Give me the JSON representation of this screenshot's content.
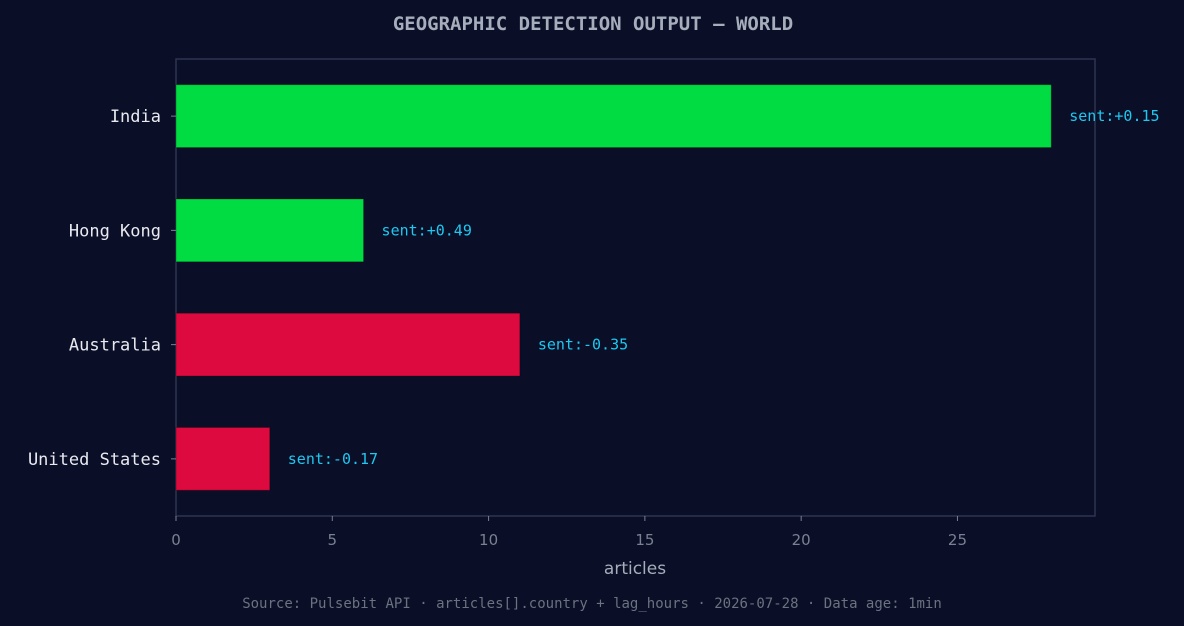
{
  "chart_data": {
    "type": "bar",
    "orientation": "horizontal",
    "title": "GEOGRAPHIC DETECTION OUTPUT — WORLD",
    "xlabel": "articles",
    "ylabel": "",
    "xlim": [
      0,
      29.4
    ],
    "xticks": [
      0,
      5,
      10,
      15,
      20,
      25
    ],
    "grid": false,
    "categories": [
      "India",
      "Hong Kong",
      "Australia",
      "United States"
    ],
    "values": [
      28,
      6,
      11,
      3
    ],
    "annotations": [
      "sent:+0.15",
      "sent:+0.49",
      "sent:-0.35",
      "sent:-0.17"
    ],
    "bar_colors": [
      "#00dc41",
      "#00dc41",
      "#dc0a3e",
      "#dc0a3e"
    ],
    "source": "Source: Pulsebit API · articles[].country + lag_hours · 2026-07-28 · Data age: 1min"
  },
  "colors": {
    "background": "#0a0e27",
    "positive": "#00dc41",
    "negative": "#dc0a3e",
    "annotation": "#1ec8f0",
    "axis": "#2e3450"
  }
}
